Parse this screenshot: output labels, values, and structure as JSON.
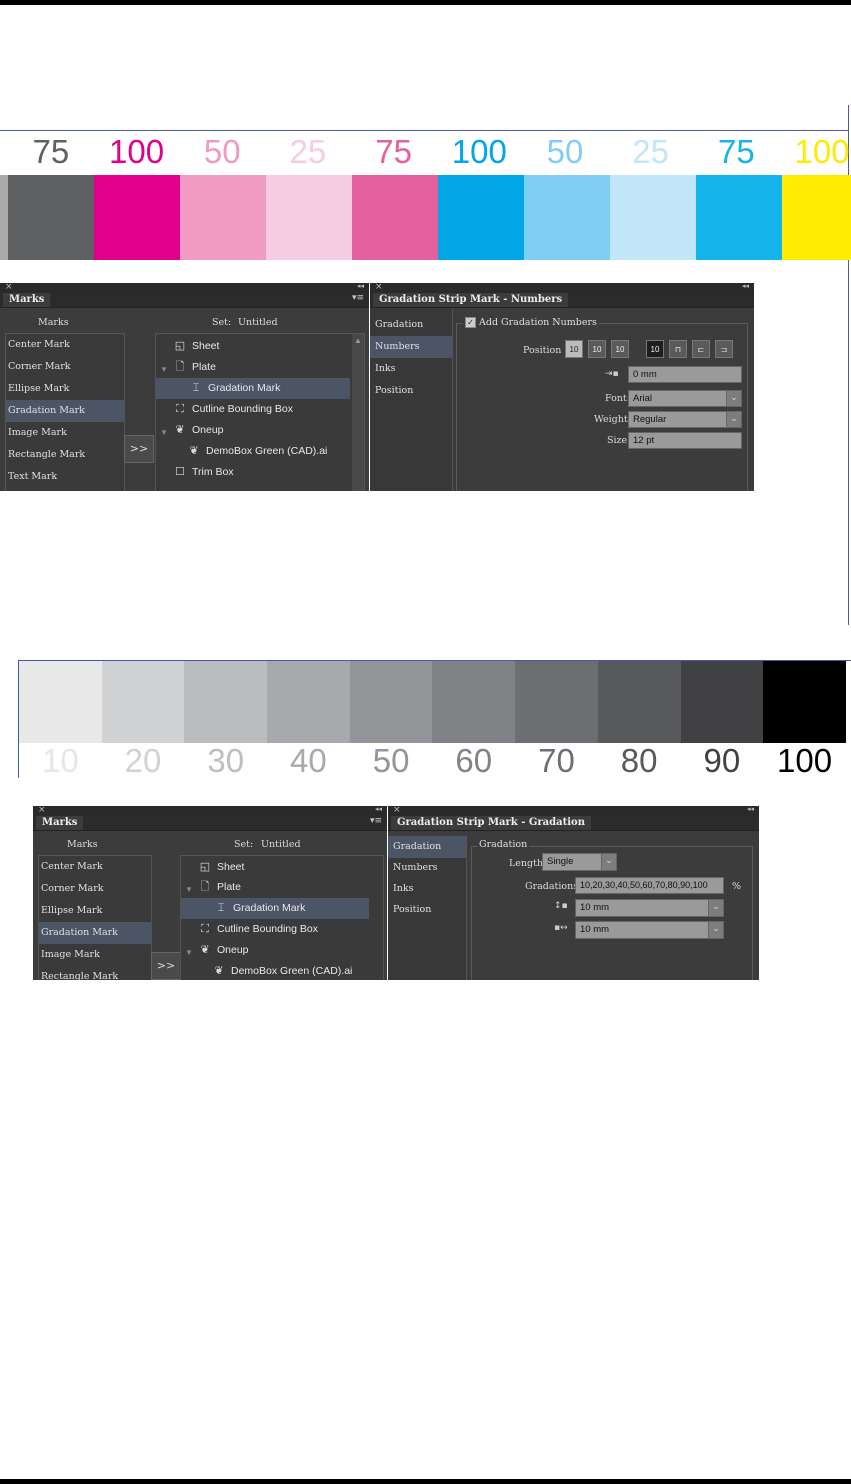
{
  "strip1": {
    "numbers": [
      {
        "text": "75",
        "color": "#5f6062"
      },
      {
        "text": "100",
        "color": "#e0008a"
      },
      {
        "text": "50",
        "color": "#f09ac4"
      },
      {
        "text": "25",
        "color": "#f6cce2"
      },
      {
        "text": "75",
        "color": "#e6609f"
      },
      {
        "text": "100",
        "color": "#00a6e6"
      },
      {
        "text": "50",
        "color": "#80cff2"
      },
      {
        "text": "25",
        "color": "#c0e6f8"
      },
      {
        "text": "75",
        "color": "#15b4ec"
      },
      {
        "text": "100",
        "color": "#ffea00"
      }
    ],
    "swatches": [
      "#aaaaaa",
      "#5f6062",
      "#e0008a",
      "#f09ac4",
      "#f6cce2",
      "#e6609f",
      "#00a6e6",
      "#80cff2",
      "#c0e6f8",
      "#15b4ec",
      "#ffec00"
    ]
  },
  "panel1": {
    "marks_tab": "Marks",
    "marks_header": "Marks",
    "set_label": "Set:",
    "set_value": "Untitled",
    "mark_list": [
      "Center Mark",
      "Corner Mark",
      "Ellipse Mark",
      "Gradation Mark",
      "Image Mark",
      "Rectangle Mark",
      "Text Mark"
    ],
    "tree": [
      "Sheet",
      "Plate",
      "Gradation Mark",
      "Cutline Bounding Box",
      "Oneup",
      "DemoBox Green (CAD).ai",
      "Trim Box"
    ],
    "add_button": ">>"
  },
  "panel2": {
    "tab": "Gradation Strip Mark - Numbers",
    "side_items": [
      "Gradation",
      "Numbers",
      "Inks",
      "Position"
    ],
    "checkbox_label": "Add Gradation Numbers",
    "position_label": "Position",
    "pos_button_text": "10",
    "offset_value": "0 mm",
    "font_label": "Font:",
    "font_value": "Arial",
    "weight_label": "Weight:",
    "weight_value": "Regular",
    "size_label": "Size:",
    "size_value": "12 pt"
  },
  "strip2": {
    "swatches": [
      "#e8e8e8",
      "#d1d2d4",
      "#bbbcbe",
      "#a7a9ac",
      "#939598",
      "#808285",
      "#6d6e71",
      "#58595b",
      "#414042",
      "#000000"
    ],
    "numbers": [
      {
        "text": "10",
        "color": "#e6e6e6"
      },
      {
        "text": "20",
        "color": "#d1d2d4"
      },
      {
        "text": "30",
        "color": "#bcbec0"
      },
      {
        "text": "40",
        "color": "#a7a9ac"
      },
      {
        "text": "50",
        "color": "#939598"
      },
      {
        "text": "60",
        "color": "#808285"
      },
      {
        "text": "70",
        "color": "#6d6e71"
      },
      {
        "text": "80",
        "color": "#58595b"
      },
      {
        "text": "90",
        "color": "#414042"
      },
      {
        "text": "100",
        "color": "#000000"
      }
    ]
  },
  "panel3": {
    "marks_tab": "Marks",
    "marks_header": "Marks",
    "set_label": "Set:",
    "set_value": "Untitled",
    "mark_list": [
      "Center Mark",
      "Corner Mark",
      "Ellipse Mark",
      "Gradation Mark",
      "Image Mark",
      "Rectangle Mark"
    ],
    "tree": [
      "Sheet",
      "Plate",
      "Gradation Mark",
      "Cutline Bounding Box",
      "Oneup",
      "DemoBox Green (CAD).ai"
    ],
    "add_button": ">>"
  },
  "panel4": {
    "tab": "Gradation Strip Mark - Gradation",
    "side_items": [
      "Gradation",
      "Numbers",
      "Inks",
      "Position"
    ],
    "group_title": "Gradation",
    "length_label": "Length:",
    "length_value": "Single",
    "gradations_label": "Gradations:",
    "gradations_value": "10,20,30,40,50,60,70,80,90,100",
    "percent": "%",
    "height_value": "10 mm",
    "width_value": "10 mm"
  }
}
